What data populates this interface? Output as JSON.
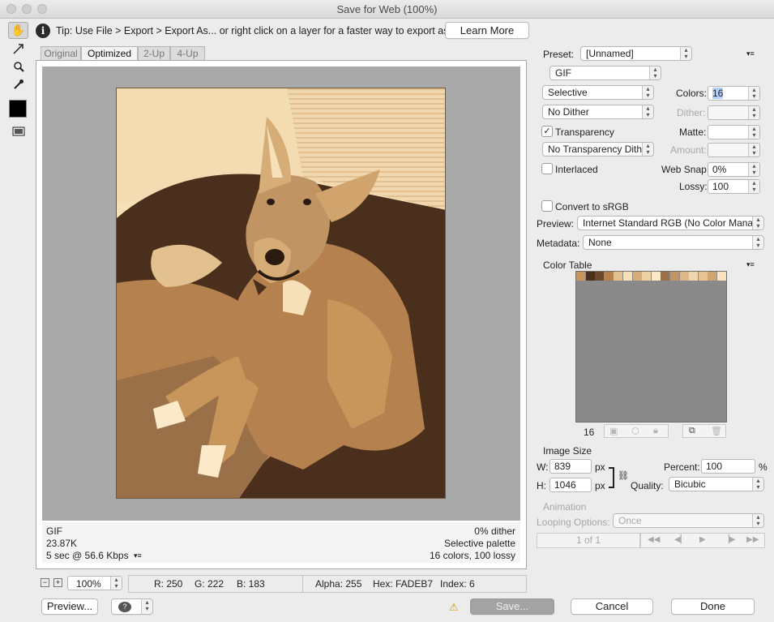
{
  "window": {
    "title": "Save for Web (100%)"
  },
  "tip": {
    "text": "Tip: Use File > Export > Export As...  or right click on a layer for a faster way to export assets",
    "learn_more": "Learn More"
  },
  "tabs": [
    "Original",
    "Optimized",
    "2-Up",
    "4-Up"
  ],
  "active_tab": "Optimized",
  "tools": [
    {
      "name": "hand-tool",
      "glyph": "✋"
    },
    {
      "name": "slice-select-tool",
      "glyph": "↗"
    },
    {
      "name": "zoom-tool",
      "glyph": "🔍"
    },
    {
      "name": "eyedropper-tool",
      "glyph": "⁄"
    }
  ],
  "image_info": {
    "format": "GIF",
    "size": "23.87K",
    "time": "5 sec @ 56.6 Kbps",
    "dither": "0% dither",
    "palette": "Selective palette",
    "colors_lossy": "16 colors, 100 lossy"
  },
  "statusbar": {
    "zoom": "100%",
    "r": "R: 250",
    "g": "G: 222",
    "b": "B: 183",
    "alpha": "Alpha: 255",
    "hex": "Hex: FADEB7",
    "index": "Index: 6"
  },
  "footer": {
    "preview": "Preview...",
    "save": "Save...",
    "cancel": "Cancel",
    "done": "Done"
  },
  "settings": {
    "preset_label": "Preset:",
    "preset": "[Unnamed]",
    "format": "GIF",
    "reduction": "Selective",
    "dither_algo": "No Dither",
    "transparency_label": "Transparency",
    "transparency_checked": true,
    "transparency_dither": "No Transparency Dither",
    "interlaced_label": "Interlaced",
    "interlaced_checked": false,
    "colors_label": "Colors:",
    "colors": "16",
    "dither_label": "Dither:",
    "matte_label": "Matte:",
    "amount_label": "Amount:",
    "websnap_label": "Web Snap:",
    "websnap": "0%",
    "lossy_label": "Lossy:",
    "lossy": "100",
    "convert_label": "Convert to sRGB",
    "convert_checked": false,
    "preview_label": "Preview:",
    "preview": "Internet Standard RGB (No Color Mana...",
    "metadata_label": "Metadata:",
    "metadata": "None"
  },
  "color_table": {
    "title": "Color Table",
    "count": "16",
    "swatches": [
      "#c8955a",
      "#4a2f1c",
      "#6b4a2c",
      "#b5824f",
      "#e3c08f",
      "#f6e0b8",
      "#d7ad77",
      "#ecd1a4",
      "#fbe9c9",
      "#9a7048",
      "#c09463",
      "#ddb786",
      "#f0d7ae",
      "#e6c592",
      "#d1a46d",
      "#f9e4bf"
    ]
  },
  "image_size": {
    "title": "Image Size",
    "w_label": "W:",
    "w": "839",
    "h_label": "H:",
    "h": "1046",
    "unit": "px",
    "percent_label": "Percent:",
    "percent": "100",
    "percent_unit": "%",
    "quality_label": "Quality:",
    "quality": "Bicubic"
  },
  "animation": {
    "title": "Animation",
    "looping_label": "Looping Options:",
    "looping": "Once",
    "frame": "1 of 1"
  },
  "colors": {
    "accent": "#3b82f6"
  }
}
